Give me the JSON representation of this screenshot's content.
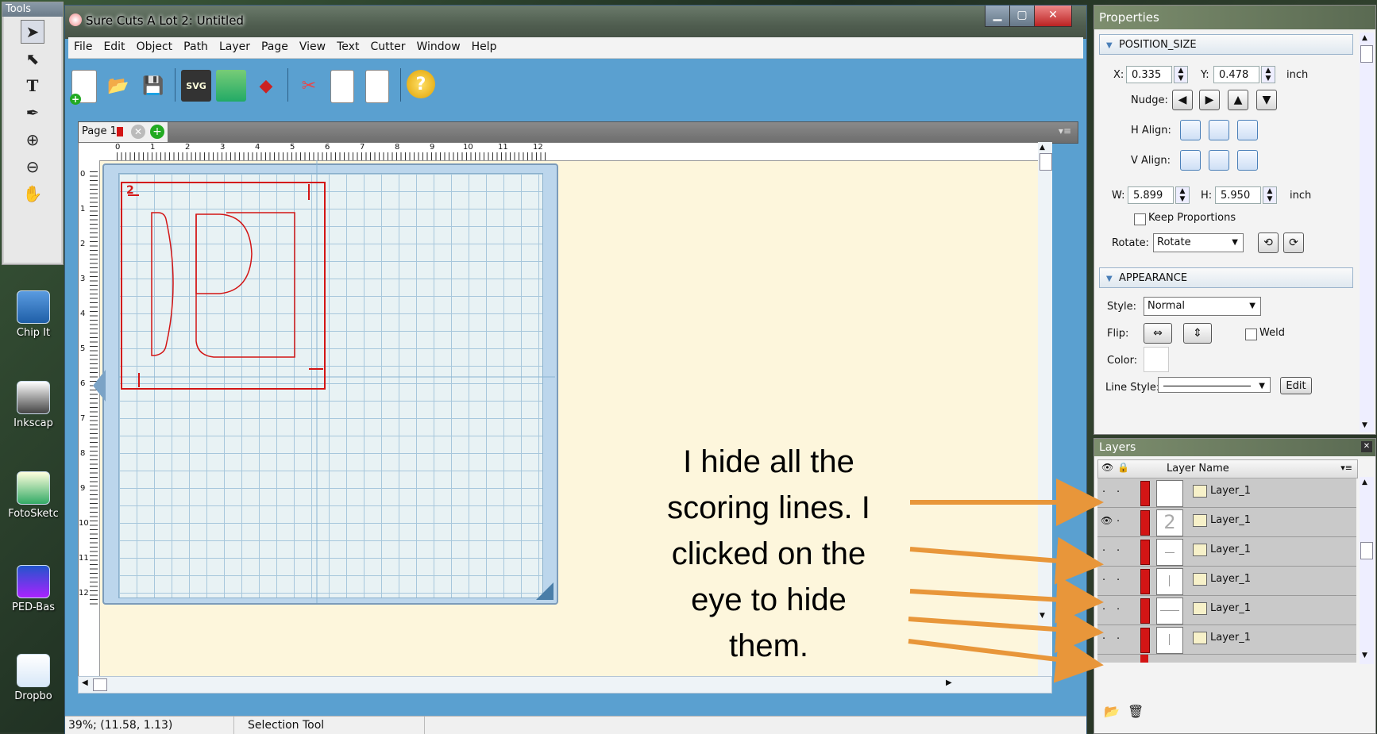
{
  "tools_panel": {
    "title": "Tools"
  },
  "desktop_icons": [
    {
      "label": "Chip It"
    },
    {
      "label": "Inkscap"
    },
    {
      "label": "FotoSketc"
    },
    {
      "label": "PED-Bas"
    },
    {
      "label": "Dropbo"
    }
  ],
  "window": {
    "title": "Sure Cuts A Lot 2: Untitled",
    "menu": [
      "File",
      "Edit",
      "Object",
      "Path",
      "Layer",
      "Page",
      "View",
      "Text",
      "Cutter",
      "Window",
      "Help"
    ],
    "toolbar_svg_label": "SVG",
    "page_tab": "Page 1",
    "ruler_h": [
      "0",
      "1",
      "2",
      "3",
      "4",
      "5",
      "6",
      "7",
      "8",
      "9",
      "10",
      "11",
      "12"
    ],
    "ruler_v": [
      "0",
      "1",
      "2",
      "3",
      "4",
      "5",
      "6",
      "7",
      "8",
      "9",
      "10",
      "11",
      "12"
    ],
    "status": {
      "zoom_coords": "39%; (11.58, 1.13)",
      "tool": "Selection Tool"
    }
  },
  "properties": {
    "title": "Properties",
    "position_size": {
      "header": "POSITION_SIZE",
      "x_label": "X:",
      "x": "0.335",
      "y_label": "Y:",
      "y": "0.478",
      "unit": "inch",
      "nudge_label": "Nudge:",
      "halign_label": "H Align:",
      "valign_label": "V Align:",
      "w_label": "W:",
      "w": "5.899",
      "h_label": "H:",
      "h": "5.950",
      "unit2": "inch",
      "keep_proportions": "Keep Proportions",
      "rotate_label": "Rotate:",
      "rotate_value": "Rotate"
    },
    "appearance": {
      "header": "APPEARANCE",
      "style_label": "Style:",
      "style_value": "Normal",
      "flip_label": "Flip:",
      "weld_label": "Weld",
      "color_label": "Color:",
      "line_style_label": "Line Style:",
      "edit_label": "Edit"
    }
  },
  "layers": {
    "title": "Layers",
    "header": "Layer Name",
    "rows": [
      {
        "name": "Layer_1",
        "visible": false
      },
      {
        "name": "Layer_1",
        "visible": true
      },
      {
        "name": "Layer_1",
        "visible": false
      },
      {
        "name": "Layer_1",
        "visible": false
      },
      {
        "name": "Layer_1",
        "visible": false
      },
      {
        "name": "Layer_1",
        "visible": false
      }
    ]
  },
  "annotation": {
    "lines": [
      "I hide all the",
      "scoring lines. I",
      "clicked on the",
      "eye to hide",
      "them."
    ]
  },
  "colors": {
    "accent": "#e8963a",
    "layer_color": "#d31515",
    "mat_blue": "#bcd6ec"
  }
}
